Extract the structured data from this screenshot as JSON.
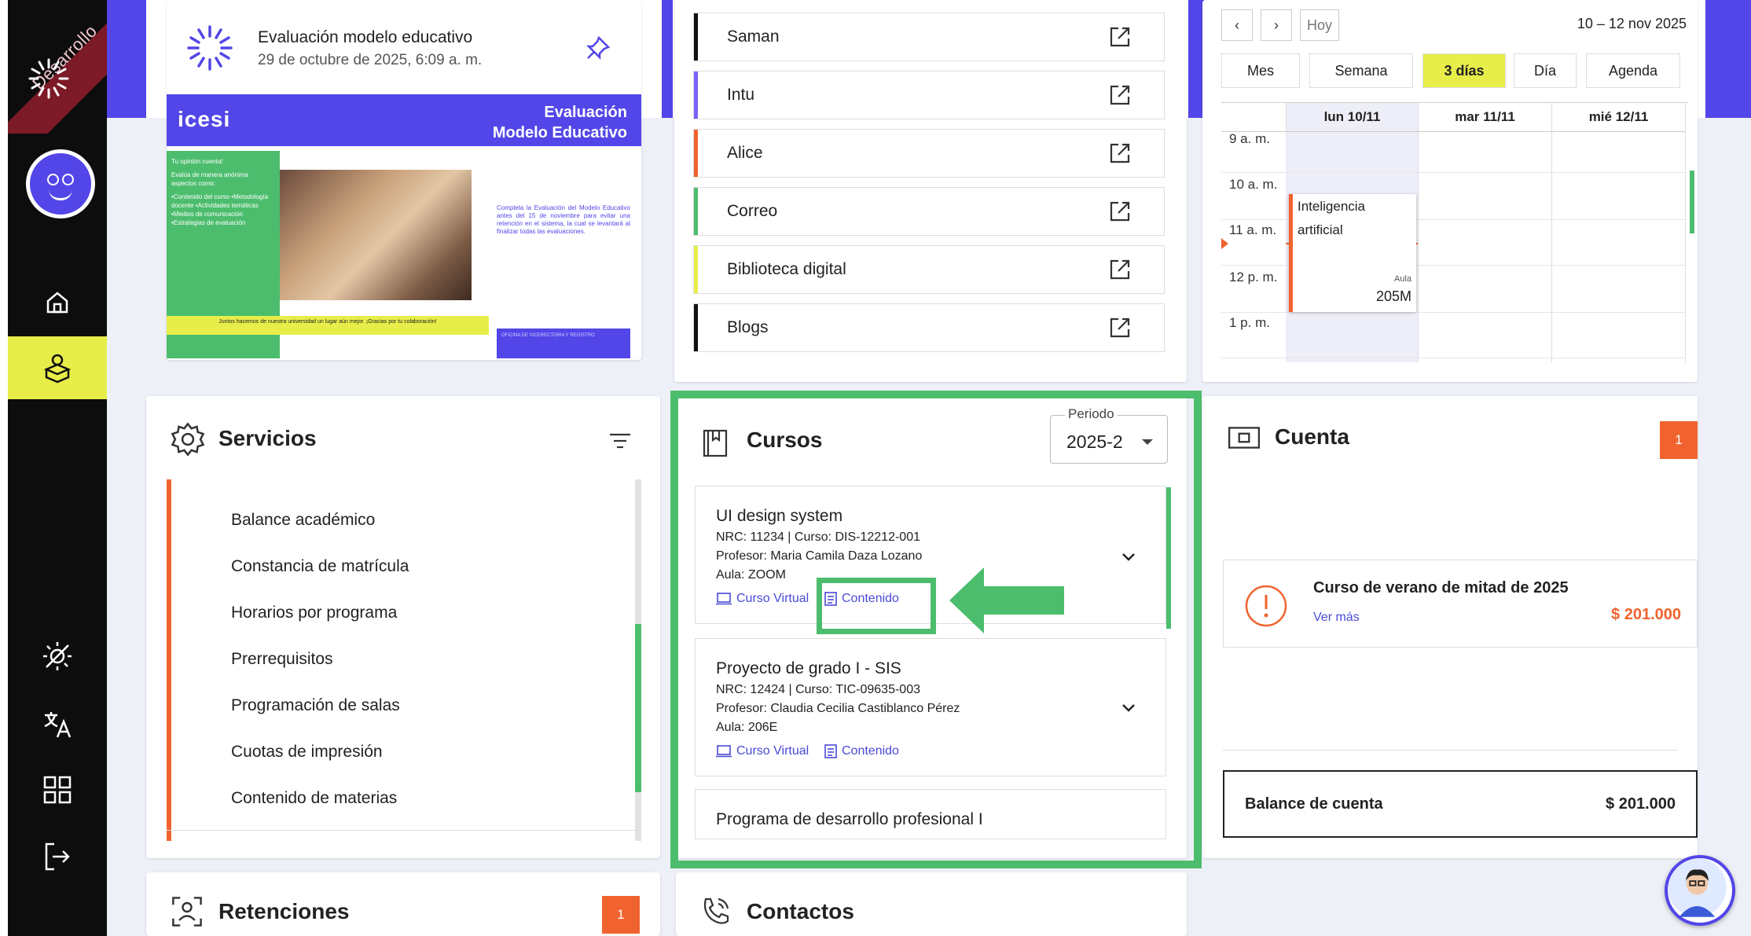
{
  "sidebar": {
    "ribbon_text": "Desarrollo",
    "nav": [
      {
        "icon": "home-icon"
      },
      {
        "icon": "academic-box-icon"
      }
    ],
    "bottom": [
      {
        "icon": "theme-toggle-icon"
      },
      {
        "icon": "translate-icon"
      },
      {
        "icon": "apps-grid-icon"
      },
      {
        "icon": "logout-icon"
      }
    ]
  },
  "announcement": {
    "title": "Evaluación modelo educativo",
    "date": "29 de octubre de 2025, 6:09 a. m.",
    "banner": {
      "logo": "icesi",
      "title_line1": "Evaluación",
      "title_line2": "Modelo Educativo",
      "green_heading": "Tu opinión cuenta!",
      "green_intro": "Evalúa de manera anónima aspectos como:",
      "green_items": "•Contenido del curso •Metodología docente •Actividades temáticas •Medios de comunicación •Estrategias de evaluación",
      "body": "Completa la Evaluación del Modelo Educativo antes del 15 de noviembre para evitar una retención en el sistema, la cual se levantará al finalizar todas las evaluaciones.",
      "yellow": "Juntos hacemos de nuestra universidad un lugar aún mejor. ¡Gracias por tu colaboración!",
      "footer": "OFICINA DE VICERECTORIA Y REGISTRO"
    }
  },
  "links": [
    {
      "label": "Saman",
      "color": "#111111"
    },
    {
      "label": "Intu",
      "color": "#7b61ff"
    },
    {
      "label": "Alice",
      "color": "#f0632e"
    },
    {
      "label": "Correo",
      "color": "#4cbd6d"
    },
    {
      "label": "Biblioteca digital",
      "color": "#e8ee49"
    },
    {
      "label": "Blogs",
      "color": "#111111"
    }
  ],
  "calendar": {
    "prev": "‹",
    "next": "›",
    "today": "Hoy",
    "range": "10 – 12 nov 2025",
    "views": [
      "Mes",
      "Semana",
      "3 días",
      "Día",
      "Agenda"
    ],
    "active_view": "3 días",
    "days": [
      "lun 10/11",
      "mar 11/11",
      "mié 12/11"
    ],
    "times": [
      "9 a. m.",
      "10 a. m.",
      "11 a. m.",
      "12 p. m.",
      "1 p. m."
    ],
    "event": {
      "title_line1": "Inteligencia",
      "title_line2": "artificial",
      "room_label": "Aula",
      "room": "205M"
    }
  },
  "servicios": {
    "title": "Servicios",
    "items": [
      "Balance académico",
      "Constancia de matrícula",
      "Horarios por programa",
      "Prerrequisitos",
      "Programación de salas",
      "Cuotas de impresión",
      "Contenido de materias"
    ]
  },
  "cursos": {
    "title": "Cursos",
    "periodo_label": "Periodo",
    "periodo_value": "2025-2",
    "courses": [
      {
        "name": "UI design system",
        "nrc": "NRC: 11234 | Curso: DIS-12212-001",
        "prof": "Profesor: Maria Camila Daza Lozano",
        "aula": "Aula: ZOOM",
        "virtual": "Curso Virtual",
        "content": "Contenido"
      },
      {
        "name": "Proyecto de grado I - SIS",
        "nrc": "NRC: 12424 | Curso: TIC-09635-003",
        "prof": "Profesor: Claudia Cecilia Castiblanco Pérez",
        "aula": "Aula: 206E",
        "virtual": "Curso Virtual",
        "content": "Contenido"
      },
      {
        "name": "Programa de desarrollo profesional I"
      }
    ]
  },
  "cuenta": {
    "title": "Cuenta",
    "badge": "1",
    "debt_title": "Curso de verano de mitad de 2025",
    "debt_link": "Ver más",
    "debt_amount": "$ 201.000",
    "balance_label": "Balance de cuenta",
    "balance_value": "$ 201.000"
  },
  "retenciones": {
    "title": "Retenciones",
    "badge": "1"
  },
  "contactos": {
    "title": "Contactos"
  },
  "colors": {
    "accent": "#5246e8",
    "green": "#4cbd6d",
    "yellow": "#e8ee49",
    "orange": "#f0632e"
  }
}
